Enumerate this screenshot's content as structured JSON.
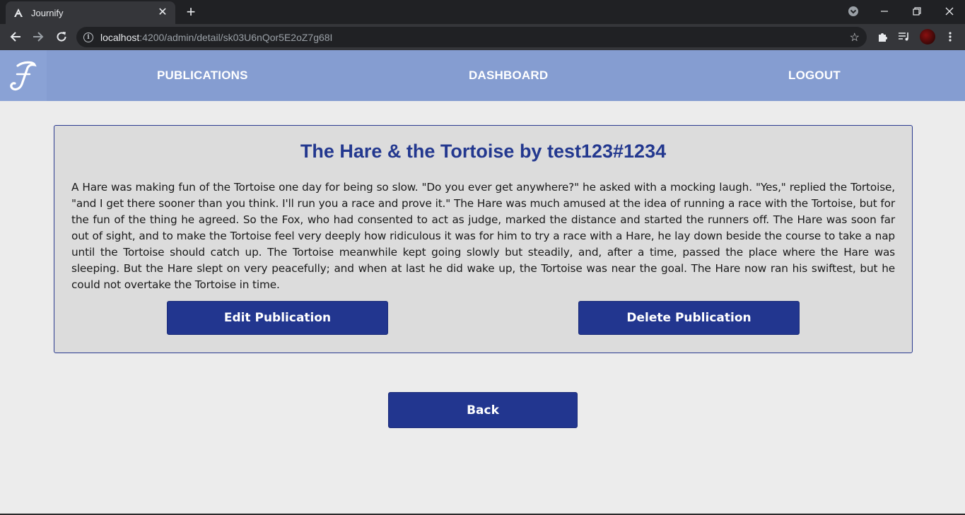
{
  "browser": {
    "tab_title": "Journify",
    "url_host": "localhost",
    "url_rest": ":4200/admin/detail/sk03U6nQor5E2oZ7g68I"
  },
  "navbar": {
    "logo_letter": "J",
    "links": [
      "PUBLICATIONS",
      "DASHBOARD",
      "LOGOUT"
    ]
  },
  "publication": {
    "title": "The Hare & the Tortoise by test123#1234",
    "body": "A Hare was making fun of the Tortoise one day for being so slow. \"Do you ever get anywhere?\" he asked with a mocking laugh. \"Yes,\" replied the Tortoise, \"and I get there sooner than you think. I'll run you a race and prove it.\" The Hare was much amused at the idea of running a race with the Tortoise, but for the fun of the thing he agreed. So the Fox, who had consented to act as judge, marked the distance and started the runners off. The Hare was soon far out of sight, and to make the Tortoise feel very deeply how ridiculous it was for him to try a race with a Hare, he lay down beside the course to take a nap until the Tortoise should catch up. The Tortoise meanwhile kept going slowly but steadily, and, after a time, passed the place where the Hare was sleeping. But the Hare slept on very peacefully; and when at last he did wake up, the Tortoise was near the goal. The Hare now ran his swiftest, but he could not overtake the Tortoise in time.",
    "edit_label": "Edit Publication",
    "delete_label": "Delete Publication"
  },
  "back_label": "Back",
  "colors": {
    "navbar": "#859dd1",
    "primary_button": "#22368f",
    "title": "#23388f",
    "card_bg": "#dcdcdc",
    "page_bg": "#ececec"
  },
  "icons": [
    "angular-favicon-icon",
    "close-icon",
    "plus-icon",
    "chevron-down-icon",
    "minimize-icon",
    "restore-icon",
    "close-window-icon",
    "back-arrow-icon",
    "forward-arrow-icon",
    "reload-icon",
    "info-icon",
    "star-icon",
    "puzzle-icon",
    "media-queue-icon",
    "more-vert-icon"
  ]
}
